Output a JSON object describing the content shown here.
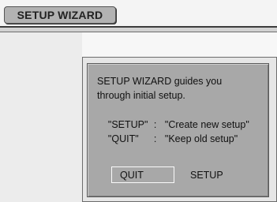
{
  "header": {
    "tab_label": "SETUP WIZARD"
  },
  "dialog": {
    "description_line1": "SETUP WIZARD guides you",
    "description_line2": "through initial setup.",
    "options": [
      {
        "key": "\"SETUP\"",
        "separator": ":",
        "meaning": "\"Create new setup\""
      },
      {
        "key": "\"QUIT\"",
        "separator": ":",
        "meaning": "\"Keep old setup\""
      }
    ],
    "buttons": {
      "quit": "QUIT",
      "setup": "SETUP"
    }
  }
}
